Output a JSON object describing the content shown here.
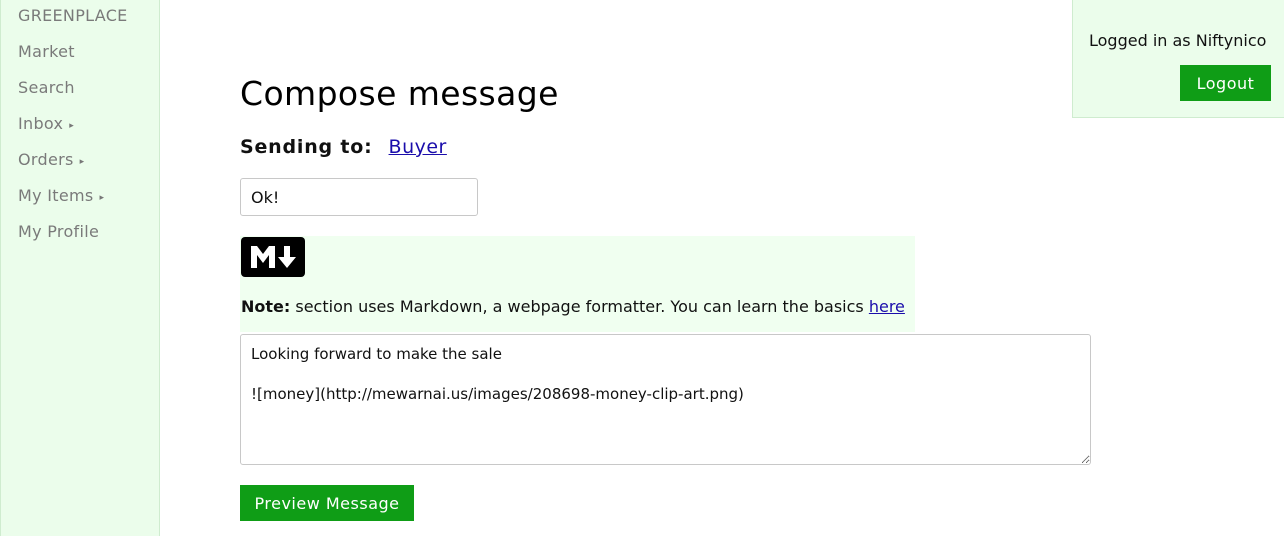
{
  "sidebar": {
    "brand": "GREENPLACE",
    "items": [
      {
        "label": "Market",
        "submenu": false
      },
      {
        "label": "Search",
        "submenu": false
      },
      {
        "label": "Inbox",
        "submenu": true
      },
      {
        "label": "Orders",
        "submenu": true
      },
      {
        "label": "My Items",
        "submenu": true
      },
      {
        "label": "My Profile",
        "submenu": false
      }
    ],
    "submenu_arrow": "▸"
  },
  "user": {
    "logged_in_text": "Logged in as Niftynico",
    "logout_label": "Logout"
  },
  "compose": {
    "title": "Compose message",
    "sending_to_label": "Sending to:",
    "recipient": "Buyer",
    "subject_value": "Ok!",
    "markdown_icon": "markdown-icon",
    "note_bold": "Note:",
    "note_text": " section uses Markdown, a webpage formatter. You can learn the basics ",
    "note_link": "here",
    "body_value": "Looking forward to make the sale\n\n![money](http://mewarnai.us/images/208698-money-clip-art.png)",
    "preview_label": "Preview Message"
  },
  "colors": {
    "accent_green": "#0f9d16",
    "panel_green": "#ebfdeb",
    "link_blue": "#1a0dab"
  }
}
